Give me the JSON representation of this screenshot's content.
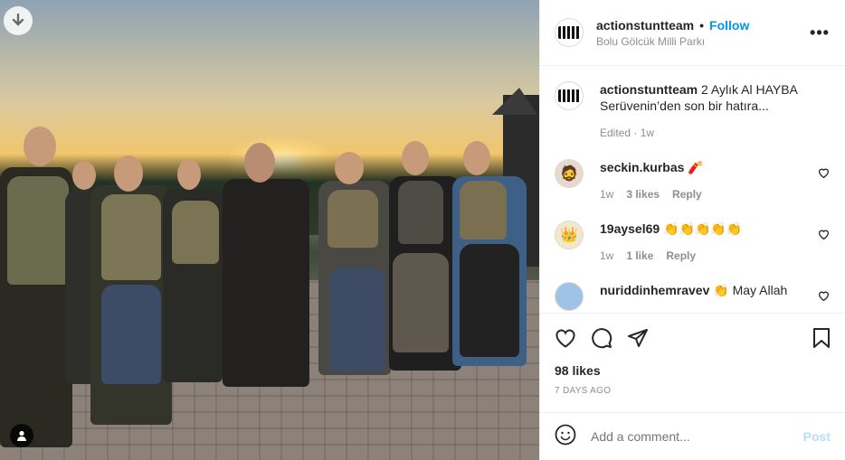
{
  "post": {
    "username": "actionstuntteam",
    "follow_label": "Follow",
    "location": "Bolu Gölcük Milli Parkı",
    "more_label": "•••"
  },
  "caption": {
    "username": "actionstuntteam",
    "text": "2 Aylık Al HAYBA Serüvenin’den son bir hatıra...",
    "edited": "Edited",
    "time": "1w"
  },
  "comments": [
    {
      "username": "seckin.kurbas",
      "text": "🧨",
      "time": "1w",
      "likes": "3 likes",
      "reply": "Reply"
    },
    {
      "username": "19aysel69",
      "text": "👏👏👏👏👏",
      "time": "1w",
      "likes": "1 like",
      "reply": "Reply"
    },
    {
      "username": "nuriddinhemravev",
      "text": "👏 May Allah",
      "time": "",
      "likes": "",
      "reply": ""
    }
  ],
  "stats": {
    "likes": "98 likes",
    "date": "7 DAYS AGO"
  },
  "composer": {
    "placeholder": "Add a comment...",
    "post_label": "Post"
  },
  "icons": [
    "download-icon",
    "user-tag-icon",
    "heart-icon",
    "comment-icon",
    "share-icon",
    "bookmark-icon",
    "emoji-icon",
    "more-icon"
  ]
}
